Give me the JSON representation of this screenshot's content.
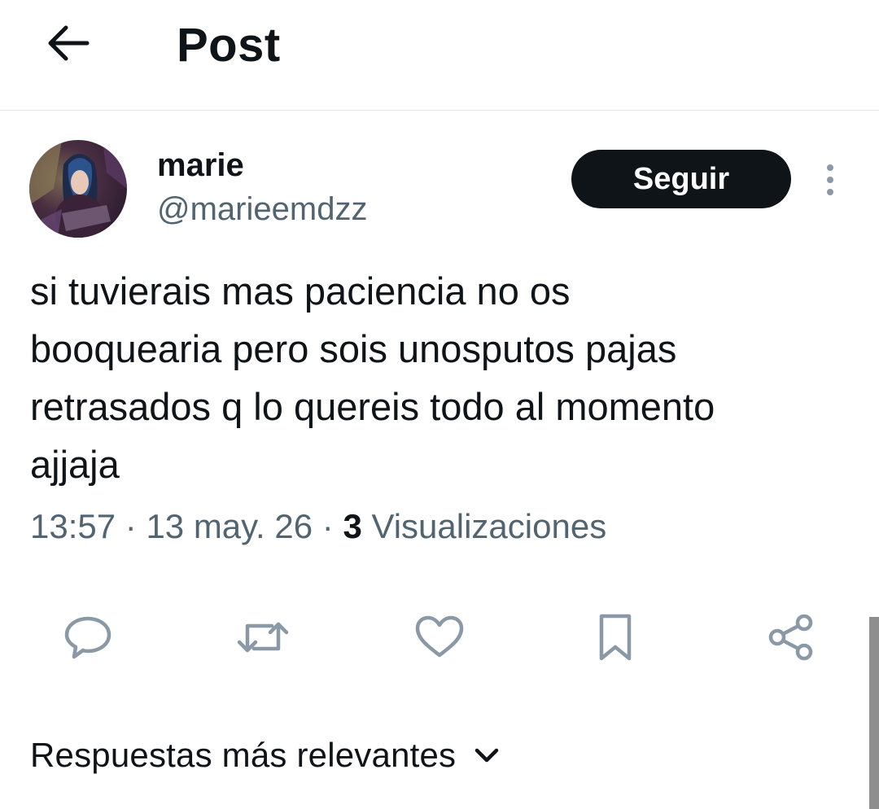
{
  "header": {
    "title": "Post",
    "back_icon": "arrow-left-icon"
  },
  "author": {
    "display_name": "marie",
    "handle": "@marieemdzz",
    "avatar_icon": "avatar-photo"
  },
  "follow_button": {
    "label": "Seguir"
  },
  "more_icon": "more-vertical-icon",
  "tweet": {
    "text": "si tuvierais mas paciencia no os\nbooquearia pero sois unosputos pajas\nretrasados q lo quereis todo al momento\najjaja"
  },
  "meta": {
    "time": "13:57",
    "separator": " · ",
    "date": "13 may. 26",
    "views_count": "3",
    "views_label": " Visualizaciones"
  },
  "actions": [
    {
      "name": "reply",
      "icon": "reply-icon"
    },
    {
      "name": "retweet",
      "icon": "retweet-icon"
    },
    {
      "name": "like",
      "icon": "heart-icon"
    },
    {
      "name": "bookmark",
      "icon": "bookmark-icon"
    },
    {
      "name": "share",
      "icon": "share-icon"
    }
  ],
  "replies_sort": {
    "label": "Respuestas más relevantes",
    "icon": "chevron-down-icon"
  },
  "colors": {
    "text_primary": "#0f1419",
    "text_secondary": "#536471",
    "icon_gray": "#8b98a5",
    "follow_bg": "#0f1419",
    "follow_text": "#ffffff"
  }
}
